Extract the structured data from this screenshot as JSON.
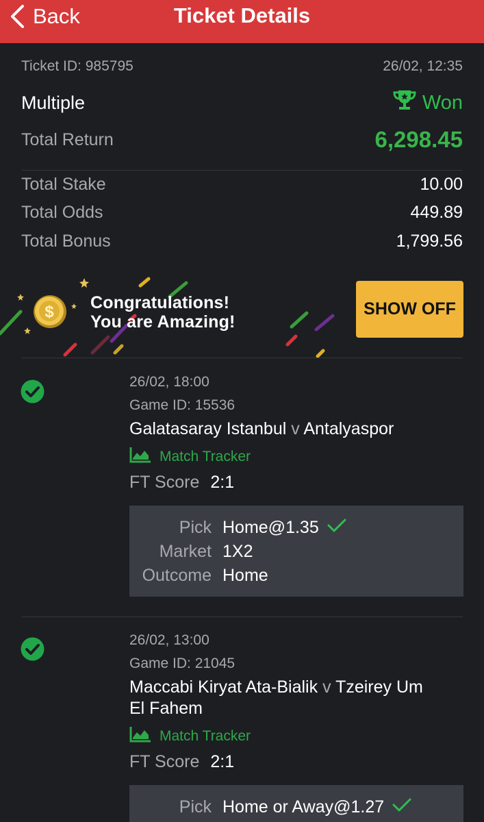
{
  "header": {
    "back_label": "Back",
    "title": "Ticket Details",
    "color": "#d7393a"
  },
  "ticket": {
    "id_label": "Ticket ID: 985795",
    "datetime": "26/02, 12:35",
    "type": "Multiple",
    "status": "Won",
    "total_return_label": "Total Return",
    "total_return": "6,298.45",
    "stake_label": "Total Stake",
    "stake": "10.00",
    "odds_label": "Total Odds",
    "odds": "449.89",
    "bonus_label": "Total Bonus",
    "bonus": "1,799.56"
  },
  "banner": {
    "line1": "Congratulations!",
    "line2": "You are Amazing!",
    "button_label": "SHOW OFF",
    "button_color": "#f1b53a"
  },
  "legs": [
    {
      "datetime": "26/02, 18:00",
      "game_id": "Game ID: 15536",
      "home": "Galatasaray Istanbul",
      "sep": "v",
      "away": "Antalyaspor",
      "tracker_label": "Match Tracker",
      "ft_label": "FT Score",
      "ft_score": "2:1",
      "pick_label": "Pick",
      "pick": "Home@1.35",
      "market_label": "Market",
      "market": "1X2",
      "outcome_label": "Outcome",
      "outcome": "Home"
    },
    {
      "datetime": "26/02, 13:00",
      "game_id": "Game ID: 21045",
      "home": "Maccabi Kiryat Ata-Bialik",
      "sep": "v",
      "away_line1": "Tzeirey Um",
      "away_line2": "El Fahem",
      "tracker_label": "Match Tracker",
      "ft_label": "FT Score",
      "ft_score": "2:1",
      "pick_label": "Pick",
      "pick": "Home or Away@1.27"
    }
  ],
  "icons": {
    "back": "chevron-left-icon",
    "won": "trophy-icon",
    "coin": "dollar-coin-icon",
    "leg_status": "check-circle-icon",
    "tracker": "chart-line-icon",
    "pick_status": "check-icon"
  },
  "colors": {
    "win_green": "#39b54a",
    "background": "#1c1e22"
  }
}
